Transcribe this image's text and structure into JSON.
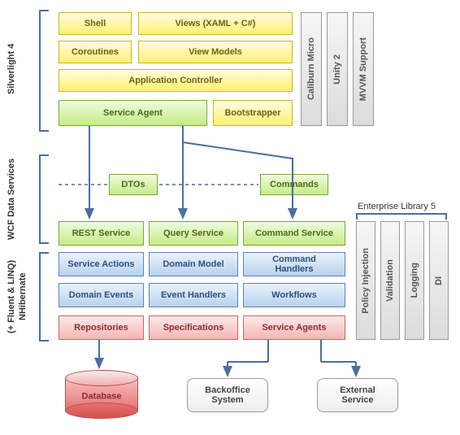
{
  "sections": {
    "silverlight": "Silverlight 4",
    "wcf": "WCF Data Services",
    "nhibernate_l1": "NHibernate",
    "nhibernate_l2": "(+ Fluent & LINQ)",
    "entlib": "Enterprise Library 5"
  },
  "sl": {
    "shell": "Shell",
    "views": "Views (XAML + C#)",
    "coroutines": "Coroutines",
    "viewmodels": "View Models",
    "appcontroller": "Application Controller",
    "serviceagent": "Service Agent",
    "bootstrapper": "Bootstrapper"
  },
  "sl_side": {
    "caliburn": "Caliburn Micro",
    "unity": "Unity 2",
    "mvvm": "MVVM Support"
  },
  "mid": {
    "dtos": "DTOs",
    "commands": "Commands"
  },
  "svc": {
    "rest": "REST Service",
    "query": "Query Service",
    "command": "Command Service"
  },
  "nh": {
    "actions": "Service Actions",
    "domain": "Domain Model",
    "cmdhandlers": "Command\nHandlers",
    "events": "Domain Events",
    "evthandlers": "Event Handlers",
    "workflows": "Workflows",
    "repos": "Repositories",
    "specs": "Specifications",
    "agents": "Service Agents"
  },
  "ent_side": {
    "policy": "Policy Injection",
    "validation": "Validation",
    "logging": "Logging",
    "di": "DI"
  },
  "bottom": {
    "db": "Database",
    "backoffice": "Backoffice\nSystem",
    "external": "External\nService"
  }
}
